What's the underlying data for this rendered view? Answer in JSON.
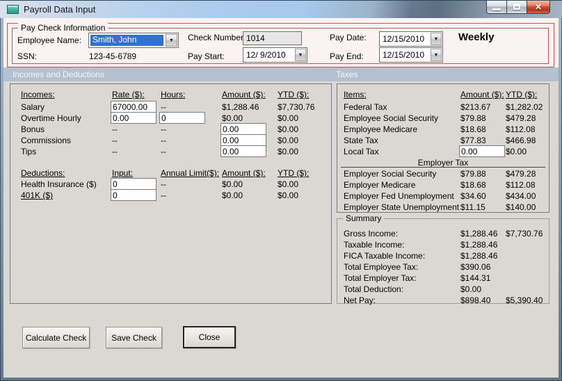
{
  "window": {
    "title": "Payroll Data Input"
  },
  "icons": {
    "dropdown_arrow": "▼",
    "close_glyph": "✕"
  },
  "paycheck": {
    "group_label": "Pay Check Information",
    "employee_name_label": "Employee Name:",
    "employee_name_value": "Smith, John",
    "ssn_label": "SSN:",
    "ssn_value": "123-45-6789",
    "check_number_label": "Check Number:",
    "check_number_value": "1014",
    "pay_start_label": "Pay Start:",
    "pay_start_value": "12/ 9/2010",
    "pay_date_label": "Pay Date:",
    "pay_date_value": "12/15/2010",
    "pay_end_label": "Pay End:",
    "pay_end_value": "12/15/2010",
    "frequency": "Weekly"
  },
  "section_bars": {
    "left": "Incomes and Deductions",
    "right": "Taxes"
  },
  "incomes": {
    "headers": {
      "c1": "Incomes:",
      "c2": "Rate ($):",
      "c3": "Hours:",
      "c4": "Amount ($):",
      "c5": "YTD ($):"
    },
    "rows": [
      {
        "label": "Salary",
        "rate": "67000.00",
        "hours": "--",
        "amount": "$1,288.46",
        "ytd": "$7,730.76"
      },
      {
        "label": "Overtime Hourly",
        "rate": "0.00",
        "hours": "0",
        "amount": "$0.00",
        "ytd": "$0.00"
      },
      {
        "label": "Bonus",
        "rate": "--",
        "hours": "--",
        "amount": "0.00",
        "ytd": "$0.00"
      },
      {
        "label": "Commissions",
        "rate": "--",
        "hours": "--",
        "amount": "0.00",
        "ytd": "$0.00"
      },
      {
        "label": "Tips",
        "rate": "--",
        "hours": "--",
        "amount": "0.00",
        "ytd": "$0.00"
      }
    ]
  },
  "deductions": {
    "headers": {
      "c1": "Deductions:",
      "c2": "Input:",
      "c3": "Annual Limit($):",
      "c4": "Amount ($):",
      "c5": "YTD ($):"
    },
    "rows": [
      {
        "label": "Health Insurance ($)",
        "input": "0",
        "limit": "--",
        "amount": "$0.00",
        "ytd": "$0.00"
      },
      {
        "label": "401K ($)",
        "input": "0",
        "limit": "--",
        "amount": "$0.00",
        "ytd": "$0.00"
      }
    ]
  },
  "taxes": {
    "headers": {
      "c1": "Items:",
      "c2": "Amount ($):",
      "c3": "YTD ($):"
    },
    "employee_rows": [
      {
        "label": "Federal Tax",
        "amount": "$213.67",
        "ytd": "$1,282.02"
      },
      {
        "label": "Employee Social Security",
        "amount": "$79.88",
        "ytd": "$479.28"
      },
      {
        "label": "Employee Medicare",
        "amount": "$18.68",
        "ytd": "$112.08"
      },
      {
        "label": "State Tax",
        "amount": "$77.83",
        "ytd": "$466.98"
      },
      {
        "label": "Local Tax",
        "amount": "0.00",
        "ytd": "$0.00"
      }
    ],
    "employer_heading": "Employer Tax",
    "employer_rows": [
      {
        "label": "Employer Social Security",
        "amount": "$79.88",
        "ytd": "$479.28"
      },
      {
        "label": "Employer Medicare",
        "amount": "$18.68",
        "ytd": "$112.08"
      },
      {
        "label": "Employer Fed Unemployment",
        "amount": "$34.60",
        "ytd": "$434.00"
      },
      {
        "label": "Employer State Unemployment",
        "amount": "$11.15",
        "ytd": "$140.00"
      }
    ]
  },
  "summary": {
    "group_label": "Summary",
    "rows": [
      {
        "label": "Gross Income:",
        "amount": "$1,288.46",
        "ytd": "$7,730.76"
      },
      {
        "label": "Taxable Income:",
        "amount": "$1,288.46",
        "ytd": ""
      },
      {
        "label": "FICA Taxable Income:",
        "amount": "$1,288.46",
        "ytd": ""
      },
      {
        "label": "Total Employee Tax:",
        "amount": "$390.06",
        "ytd": ""
      },
      {
        "label": "Total Employer Tax:",
        "amount": "$144.31",
        "ytd": ""
      },
      {
        "label": "Total Deduction:",
        "amount": "$0.00",
        "ytd": ""
      },
      {
        "label": "Net Pay:",
        "amount": "$898.40",
        "ytd": "$5,390.40"
      }
    ]
  },
  "buttons": {
    "calculate": "Calculate Check",
    "save": "Save Check",
    "close": "Close"
  }
}
